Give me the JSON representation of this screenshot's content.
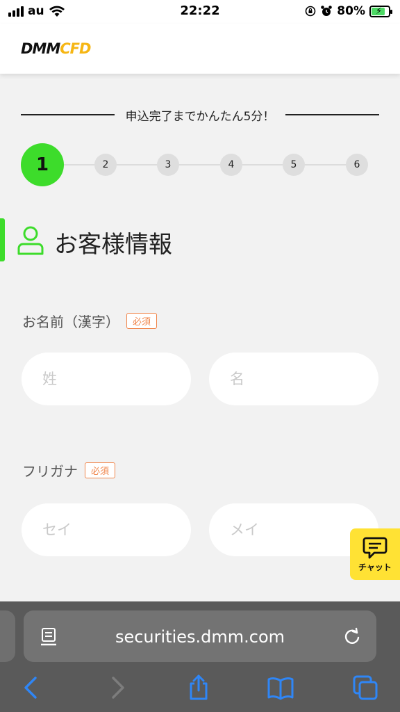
{
  "status_bar": {
    "carrier": "au",
    "time": "22:22",
    "battery_percent": "80%",
    "battery_level": 0.8,
    "icons": [
      "signal-icon",
      "wifi-icon",
      "orientation-lock-icon",
      "alarm-icon",
      "battery-charging-icon"
    ]
  },
  "header": {
    "logo_primary": "DMM",
    "logo_secondary": "CFD"
  },
  "progress": {
    "tagline": "申込完了までかんたん5分！",
    "current_step": 1,
    "steps": [
      "1",
      "2",
      "3",
      "4",
      "5",
      "6"
    ]
  },
  "section": {
    "title": "お客様情報",
    "icon": "user-icon"
  },
  "form": {
    "name_kanji": {
      "label": "お名前（漢字）",
      "required_badge": "必須",
      "last_placeholder": "姓",
      "first_placeholder": "名",
      "last_value": "",
      "first_value": ""
    },
    "name_kana": {
      "label": "フリガナ",
      "required_badge": "必須",
      "last_placeholder": "セイ",
      "first_placeholder": "メイ",
      "last_value": "",
      "first_value": ""
    }
  },
  "chat": {
    "label": "チャット",
    "icon": "chat-bubble-icon"
  },
  "browser": {
    "url": "securities.dmm.com",
    "toolbar_icons": [
      "back-icon",
      "forward-icon",
      "share-icon",
      "bookmarks-icon",
      "tabs-icon"
    ]
  },
  "colors": {
    "accent_green": "#3ddc2b",
    "required_orange": "#f0854a",
    "chat_yellow": "#ffe234",
    "logo_yellow": "#f6b614",
    "ios_blue": "#2f86f6"
  }
}
